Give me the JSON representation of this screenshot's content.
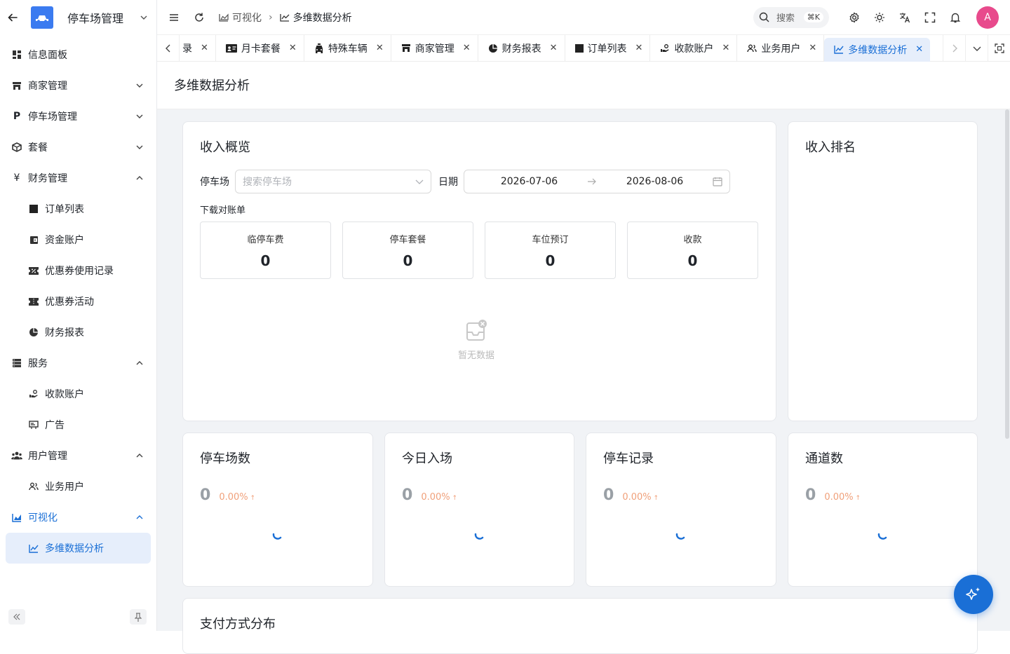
{
  "app": {
    "title": "停车场管理"
  },
  "sidebar": {
    "items": [
      {
        "label": "信息面板"
      },
      {
        "label": "商家管理"
      },
      {
        "label": "停车场管理"
      },
      {
        "label": "套餐"
      },
      {
        "label": "财务管理"
      },
      {
        "label": "订单列表"
      },
      {
        "label": "资金账户"
      },
      {
        "label": "优惠券使用记录"
      },
      {
        "label": "优惠券活动"
      },
      {
        "label": "财务报表"
      },
      {
        "label": "服务"
      },
      {
        "label": "收款账户"
      },
      {
        "label": "广告"
      },
      {
        "label": "用户管理"
      },
      {
        "label": "业务用户"
      },
      {
        "label": "可视化"
      },
      {
        "label": "多维数据分析"
      }
    ],
    "accent": "#1a6fd6"
  },
  "header": {
    "breadcrumb": {
      "parent": "可视化",
      "current": "多维数据分析"
    },
    "search": {
      "label": "搜索",
      "shortcut": "⌘K"
    },
    "avatar": "A"
  },
  "tabs": [
    {
      "label": "录"
    },
    {
      "label": "月卡套餐"
    },
    {
      "label": "特殊车辆"
    },
    {
      "label": "商家管理"
    },
    {
      "label": "财务报表"
    },
    {
      "label": "订单列表"
    },
    {
      "label": "收款账户"
    },
    {
      "label": "业务用户"
    },
    {
      "label": "多维数据分析"
    }
  ],
  "page": {
    "title": "多维数据分析"
  },
  "income": {
    "title": "收入概览",
    "lot_label": "停车场",
    "lot_placeholder": "搜索停车场",
    "date_label": "日期",
    "date_start": "2026-07-06",
    "date_end": "2026-08-06",
    "download": "下载对账单",
    "stats": [
      {
        "name": "临停车费",
        "value": "0"
      },
      {
        "name": "停车套餐",
        "value": "0"
      },
      {
        "name": "车位预订",
        "value": "0"
      },
      {
        "name": "收款",
        "value": "0"
      }
    ],
    "empty": "暂无数据"
  },
  "ranking": {
    "title": "收入排名"
  },
  "kpis": [
    {
      "title": "停车场数",
      "value": "0",
      "pct": "0.00%"
    },
    {
      "title": "今日入场",
      "value": "0",
      "pct": "0.00%"
    },
    {
      "title": "停车记录",
      "value": "0",
      "pct": "0.00%"
    },
    {
      "title": "通道数",
      "value": "0",
      "pct": "0.00%"
    }
  ],
  "payment": {
    "title": "支付方式分布"
  }
}
